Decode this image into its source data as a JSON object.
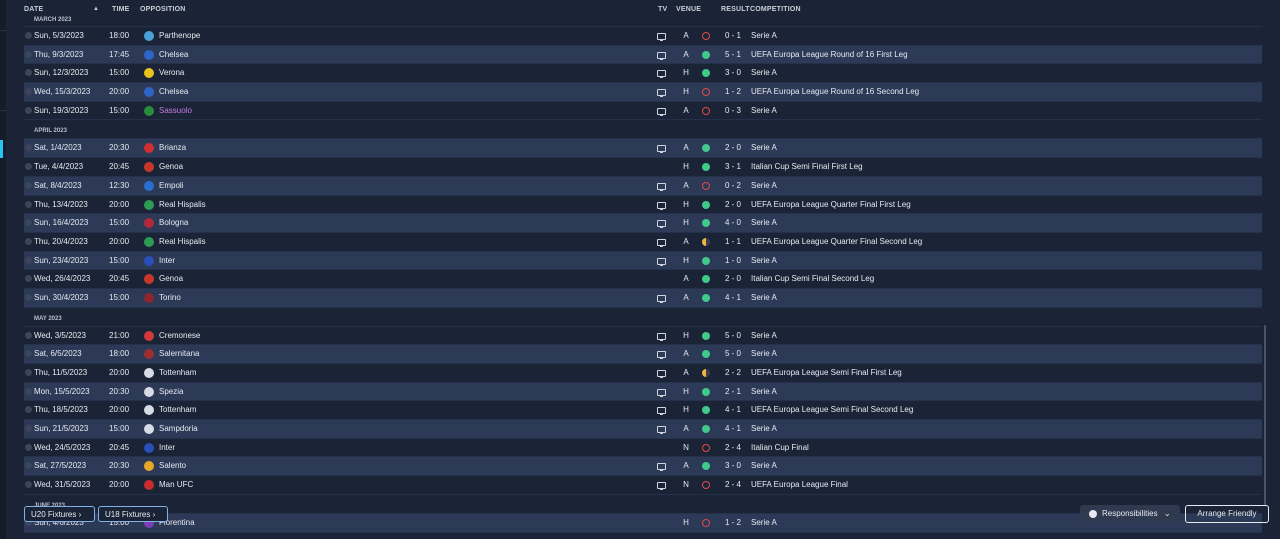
{
  "header": {
    "date": "DATE",
    "time": "TIME",
    "opposition": "OPPOSITION",
    "tv": "TV",
    "venue": "VENUE",
    "result": "RESULT",
    "competition": "COMPETITION"
  },
  "months": [
    {
      "label": "MARCH 2023",
      "fixtures": [
        {
          "date": "Sun, 5/3/2023",
          "time": "18:00",
          "opp": "Parthenope",
          "badge": "#49a3db",
          "tv": true,
          "venue": "A",
          "result": "L",
          "score": "0 - 1",
          "comp": "Serie A"
        },
        {
          "date": "Thu, 9/3/2023",
          "time": "17:45",
          "opp": "Chelsea",
          "badge": "#2f65c9",
          "tv": true,
          "venue": "A",
          "result": "W",
          "score": "5 - 1",
          "comp": "UEFA Europa League Round of 16 First Leg"
        },
        {
          "date": "Sun, 12/3/2023",
          "time": "15:00",
          "opp": "Verona",
          "badge": "#e8c21d",
          "tv": true,
          "venue": "H",
          "result": "W",
          "score": "3 - 0",
          "comp": "Serie A"
        },
        {
          "date": "Wed, 15/3/2023",
          "time": "20:00",
          "opp": "Chelsea",
          "badge": "#2f65c9",
          "tv": true,
          "venue": "H",
          "result": "L",
          "score": "1 - 2",
          "comp": "UEFA Europa League Round of 16 Second Leg"
        },
        {
          "date": "Sun, 19/3/2023",
          "time": "15:00",
          "opp": "Sassuolo",
          "badge": "#2b8c3d",
          "tv": true,
          "venue": "A",
          "result": "L",
          "score": "0 - 3",
          "comp": "Serie A",
          "highlight": true
        }
      ]
    },
    {
      "label": "APRIL 2023",
      "fixtures": [
        {
          "date": "Sat, 1/4/2023",
          "time": "20:30",
          "opp": "Brianza",
          "badge": "#d03030",
          "tv": true,
          "venue": "A",
          "result": "W",
          "score": "2 - 0",
          "comp": "Serie A"
        },
        {
          "date": "Tue, 4/4/2023",
          "time": "20:45",
          "opp": "Genoa",
          "badge": "#c8382a",
          "tv": false,
          "venue": "H",
          "result": "W",
          "score": "3 - 1",
          "comp": "Italian Cup Semi Final First Leg"
        },
        {
          "date": "Sat, 8/4/2023",
          "time": "12:30",
          "opp": "Empoli",
          "badge": "#2a6fcf",
          "tv": true,
          "venue": "A",
          "result": "L",
          "score": "0 - 2",
          "comp": "Serie A"
        },
        {
          "date": "Thu, 13/4/2023",
          "time": "20:00",
          "opp": "Real Hispalis",
          "badge": "#2e9b55",
          "tv": true,
          "venue": "H",
          "result": "W",
          "score": "2 - 0",
          "comp": "UEFA Europa League Quarter Final First Leg"
        },
        {
          "date": "Sun, 16/4/2023",
          "time": "15:00",
          "opp": "Bologna",
          "badge": "#b3283b",
          "tv": true,
          "venue": "H",
          "result": "W",
          "score": "4 - 0",
          "comp": "Serie A"
        },
        {
          "date": "Thu, 20/4/2023",
          "time": "20:00",
          "opp": "Real Hispalis",
          "badge": "#2e9b55",
          "tv": true,
          "venue": "A",
          "result": "D",
          "score": "1 - 1",
          "comp": "UEFA Europa League Quarter Final Second Leg"
        },
        {
          "date": "Sun, 23/4/2023",
          "time": "15:00",
          "opp": "Inter",
          "badge": "#2b4fb8",
          "tv": true,
          "venue": "H",
          "result": "W",
          "score": "1 - 0",
          "comp": "Serie A"
        },
        {
          "date": "Wed, 26/4/2023",
          "time": "20:45",
          "opp": "Genoa",
          "badge": "#c8382a",
          "tv": false,
          "venue": "A",
          "result": "W",
          "score": "2 - 0",
          "comp": "Italian Cup Semi Final Second Leg"
        },
        {
          "date": "Sun, 30/4/2023",
          "time": "15:00",
          "opp": "Torino",
          "badge": "#8c2630",
          "tv": true,
          "venue": "A",
          "result": "W",
          "score": "4 - 1",
          "comp": "Serie A"
        }
      ]
    },
    {
      "label": "MAY 2023",
      "fixtures": [
        {
          "date": "Wed, 3/5/2023",
          "time": "21:00",
          "opp": "Cremonese",
          "badge": "#d23a3a",
          "tv": true,
          "venue": "H",
          "result": "W",
          "score": "5 - 0",
          "comp": "Serie A"
        },
        {
          "date": "Sat, 6/5/2023",
          "time": "18:00",
          "opp": "Salernitana",
          "badge": "#9b2f2f",
          "tv": true,
          "venue": "A",
          "result": "W",
          "score": "5 - 0",
          "comp": "Serie A"
        },
        {
          "date": "Thu, 11/5/2023",
          "time": "20:00",
          "opp": "Tottenham",
          "badge": "#d6dbe4",
          "tv": true,
          "venue": "A",
          "result": "D",
          "score": "2 - 2",
          "comp": "UEFA Europa League Semi Final First Leg"
        },
        {
          "date": "Mon, 15/5/2023",
          "time": "20:30",
          "opp": "Spezia",
          "badge": "#d6dbe4",
          "tv": true,
          "venue": "H",
          "result": "W",
          "score": "2 - 1",
          "comp": "Serie A"
        },
        {
          "date": "Thu, 18/5/2023",
          "time": "20:00",
          "opp": "Tottenham",
          "badge": "#d6dbe4",
          "tv": true,
          "venue": "H",
          "result": "W",
          "score": "4 - 1",
          "comp": "UEFA Europa League Semi Final Second Leg"
        },
        {
          "date": "Sun, 21/5/2023",
          "time": "15:00",
          "opp": "Sampdoria",
          "badge": "#d6dbe4",
          "tv": true,
          "venue": "A",
          "result": "W",
          "score": "4 - 1",
          "comp": "Serie A"
        },
        {
          "date": "Wed, 24/5/2023",
          "time": "20:45",
          "opp": "Inter",
          "badge": "#2b4fb8",
          "tv": false,
          "venue": "N",
          "result": "L",
          "score": "2 - 4",
          "comp": "Italian Cup Final"
        },
        {
          "date": "Sat, 27/5/2023",
          "time": "20:30",
          "opp": "Salento",
          "badge": "#e8a826",
          "tv": true,
          "venue": "A",
          "result": "W",
          "score": "3 - 0",
          "comp": "Serie A"
        },
        {
          "date": "Wed, 31/5/2023",
          "time": "20:00",
          "opp": "Man UFC",
          "badge": "#c82d2d",
          "tv": true,
          "venue": "N",
          "result": "L",
          "score": "2 - 4",
          "comp": "UEFA Europa League Final"
        }
      ]
    },
    {
      "label": "JUNE 2023",
      "fixtures": [
        {
          "date": "Sun, 4/6/2023",
          "time": "15:00",
          "opp": "Fiorentina",
          "badge": "#7a3fb4",
          "tv": false,
          "venue": "H",
          "result": "L",
          "score": "1 - 2",
          "comp": "Serie A"
        }
      ]
    }
  ],
  "buttons": {
    "u20": "U20 Fixtures",
    "u18": "U18 Fixtures",
    "responsibilities": "Responsibilities",
    "arrange": "Arrange Friendly"
  }
}
